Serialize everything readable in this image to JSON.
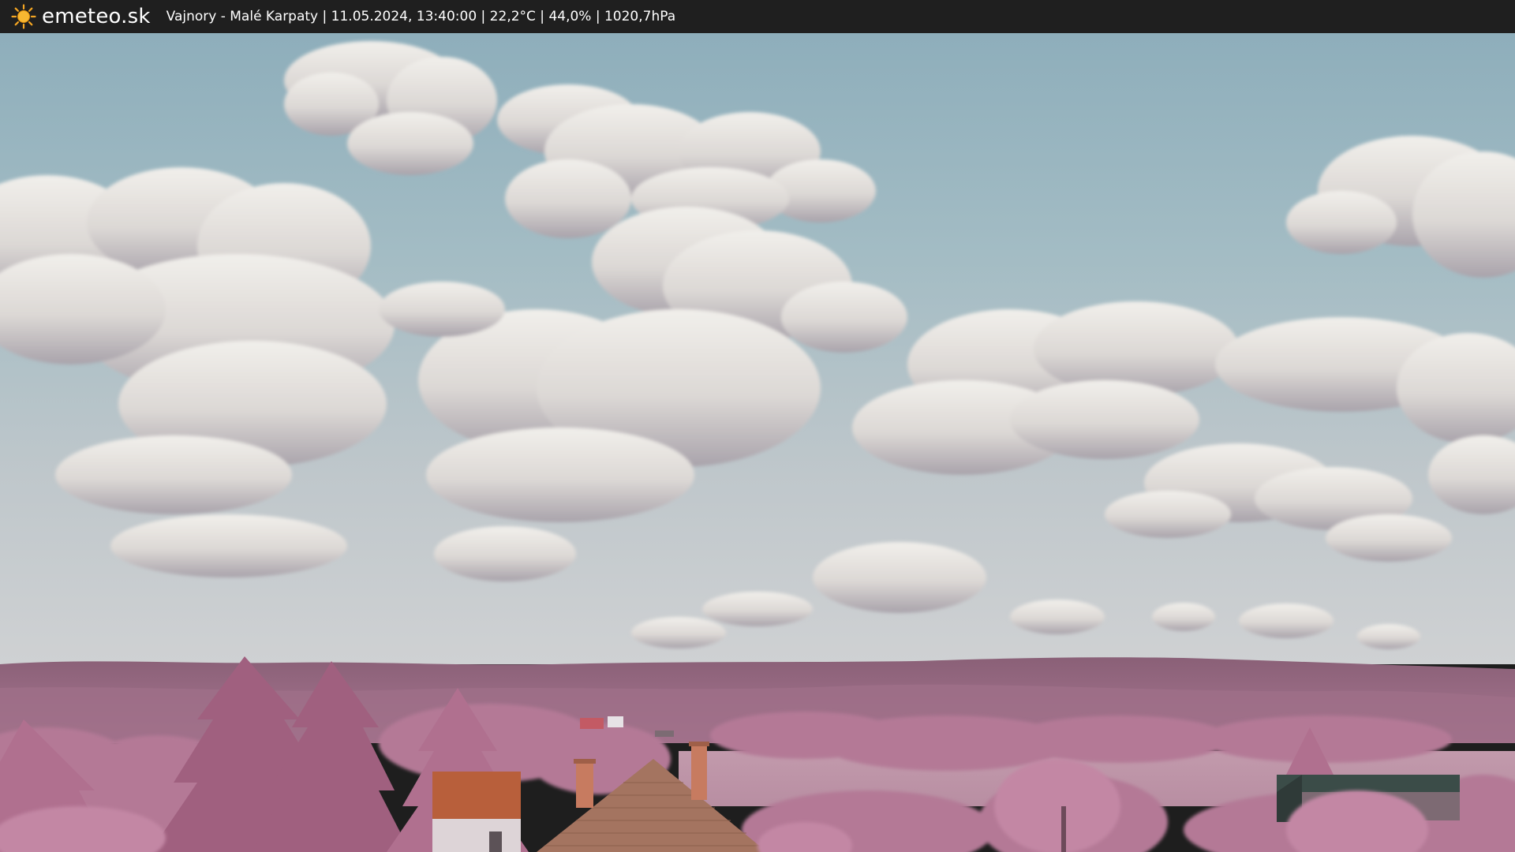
{
  "header": {
    "brand": "emeteo.sk",
    "info": "Vajnory - Malé Karpaty | 11.05.2024, 13:40:00 | 22,2°C | 44,0% | 1020,7hPa",
    "logo_icon": "sun-icon"
  },
  "colors": {
    "bar": "#1f1f1f",
    "sun": "#f5a623",
    "sky_top": "#8fb3c2",
    "sky_bottom": "#c9cdd0",
    "foliage": "#b77a9a",
    "hills": "#8e6378",
    "roof": "#b85f3b"
  }
}
